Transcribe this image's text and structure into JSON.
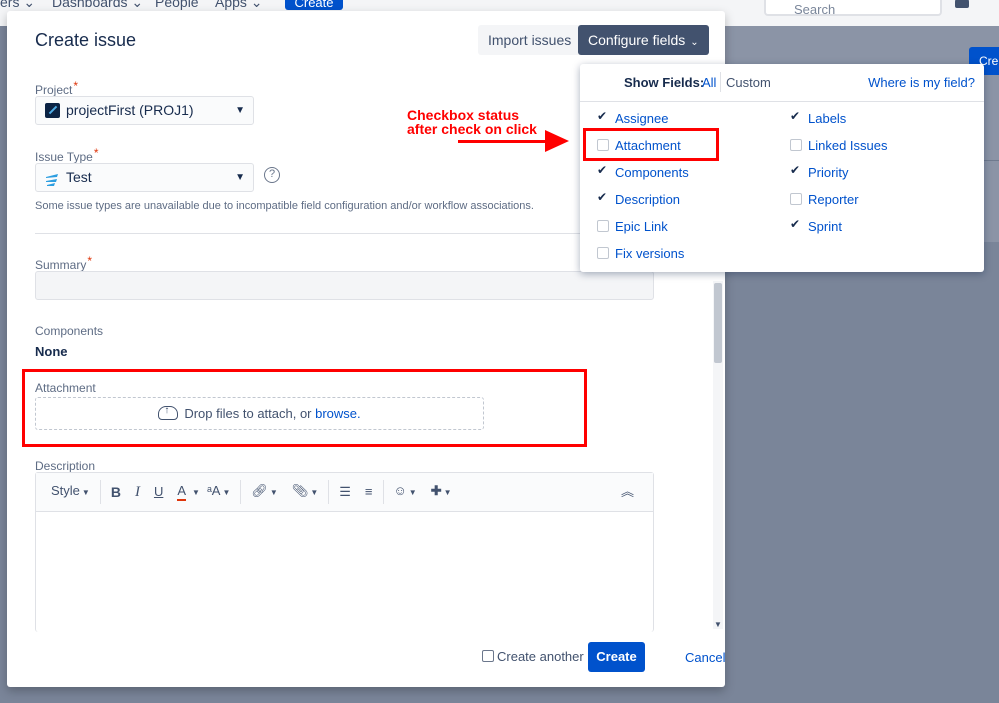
{
  "background": {
    "nav_items": [
      "ers ⌄",
      "Dashboards ⌄",
      "People",
      "Apps ⌄"
    ],
    "create_label": "Create",
    "search_placeholder": "Search",
    "right_create_label": "Cre"
  },
  "dialog": {
    "title": "Create issue",
    "import_label": "Import issues",
    "configure_label": "Configure fields",
    "project": {
      "label": "Project",
      "value": "projectFirst (PROJ1)"
    },
    "issue_type": {
      "label": "Issue Type",
      "value": "Test",
      "help": "?",
      "hint": "Some issue types are unavailable due to incompatible field configuration and/or workflow associations."
    },
    "summary": {
      "label": "Summary",
      "value": ""
    },
    "components": {
      "label": "Components",
      "value": "None"
    },
    "attachment": {
      "label": "Attachment",
      "drop_text": "Drop files to attach, or ",
      "browse_link": "browse."
    },
    "description": {
      "label": "Description",
      "toolbar": {
        "style": "Style",
        "bold": "B",
        "italic": "I",
        "underline": "U",
        "color": "A",
        "size": "ᵃA"
      }
    },
    "footer": {
      "create_another": "Create another",
      "create_another_checked": false,
      "create_label": "Create",
      "cancel_label": "Cancel"
    },
    "required_marker": "*"
  },
  "configure_popup": {
    "show_fields_label": "Show Fields:",
    "all_label": "All",
    "custom_label": "Custom",
    "where_link": "Where is my field?",
    "fields_left": [
      {
        "label": "Assignee",
        "checked": true
      },
      {
        "label": "Attachment",
        "checked": false
      },
      {
        "label": "Components",
        "checked": true
      },
      {
        "label": "Description",
        "checked": true
      },
      {
        "label": "Epic Link",
        "checked": false
      },
      {
        "label": "Fix versions",
        "checked": false
      }
    ],
    "fields_right": [
      {
        "label": "Labels",
        "checked": true
      },
      {
        "label": "Linked Issues",
        "checked": false
      },
      {
        "label": "Priority",
        "checked": true
      },
      {
        "label": "Reporter",
        "checked": false
      },
      {
        "label": "Sprint",
        "checked": true
      }
    ]
  },
  "annotation": {
    "line1": "Checkbox status",
    "line2": "after check on click"
  },
  "colors": {
    "accent": "#0052cc",
    "annotation": "#ff0000",
    "overlay": "#7a8599",
    "configure_button": "#42526e"
  }
}
